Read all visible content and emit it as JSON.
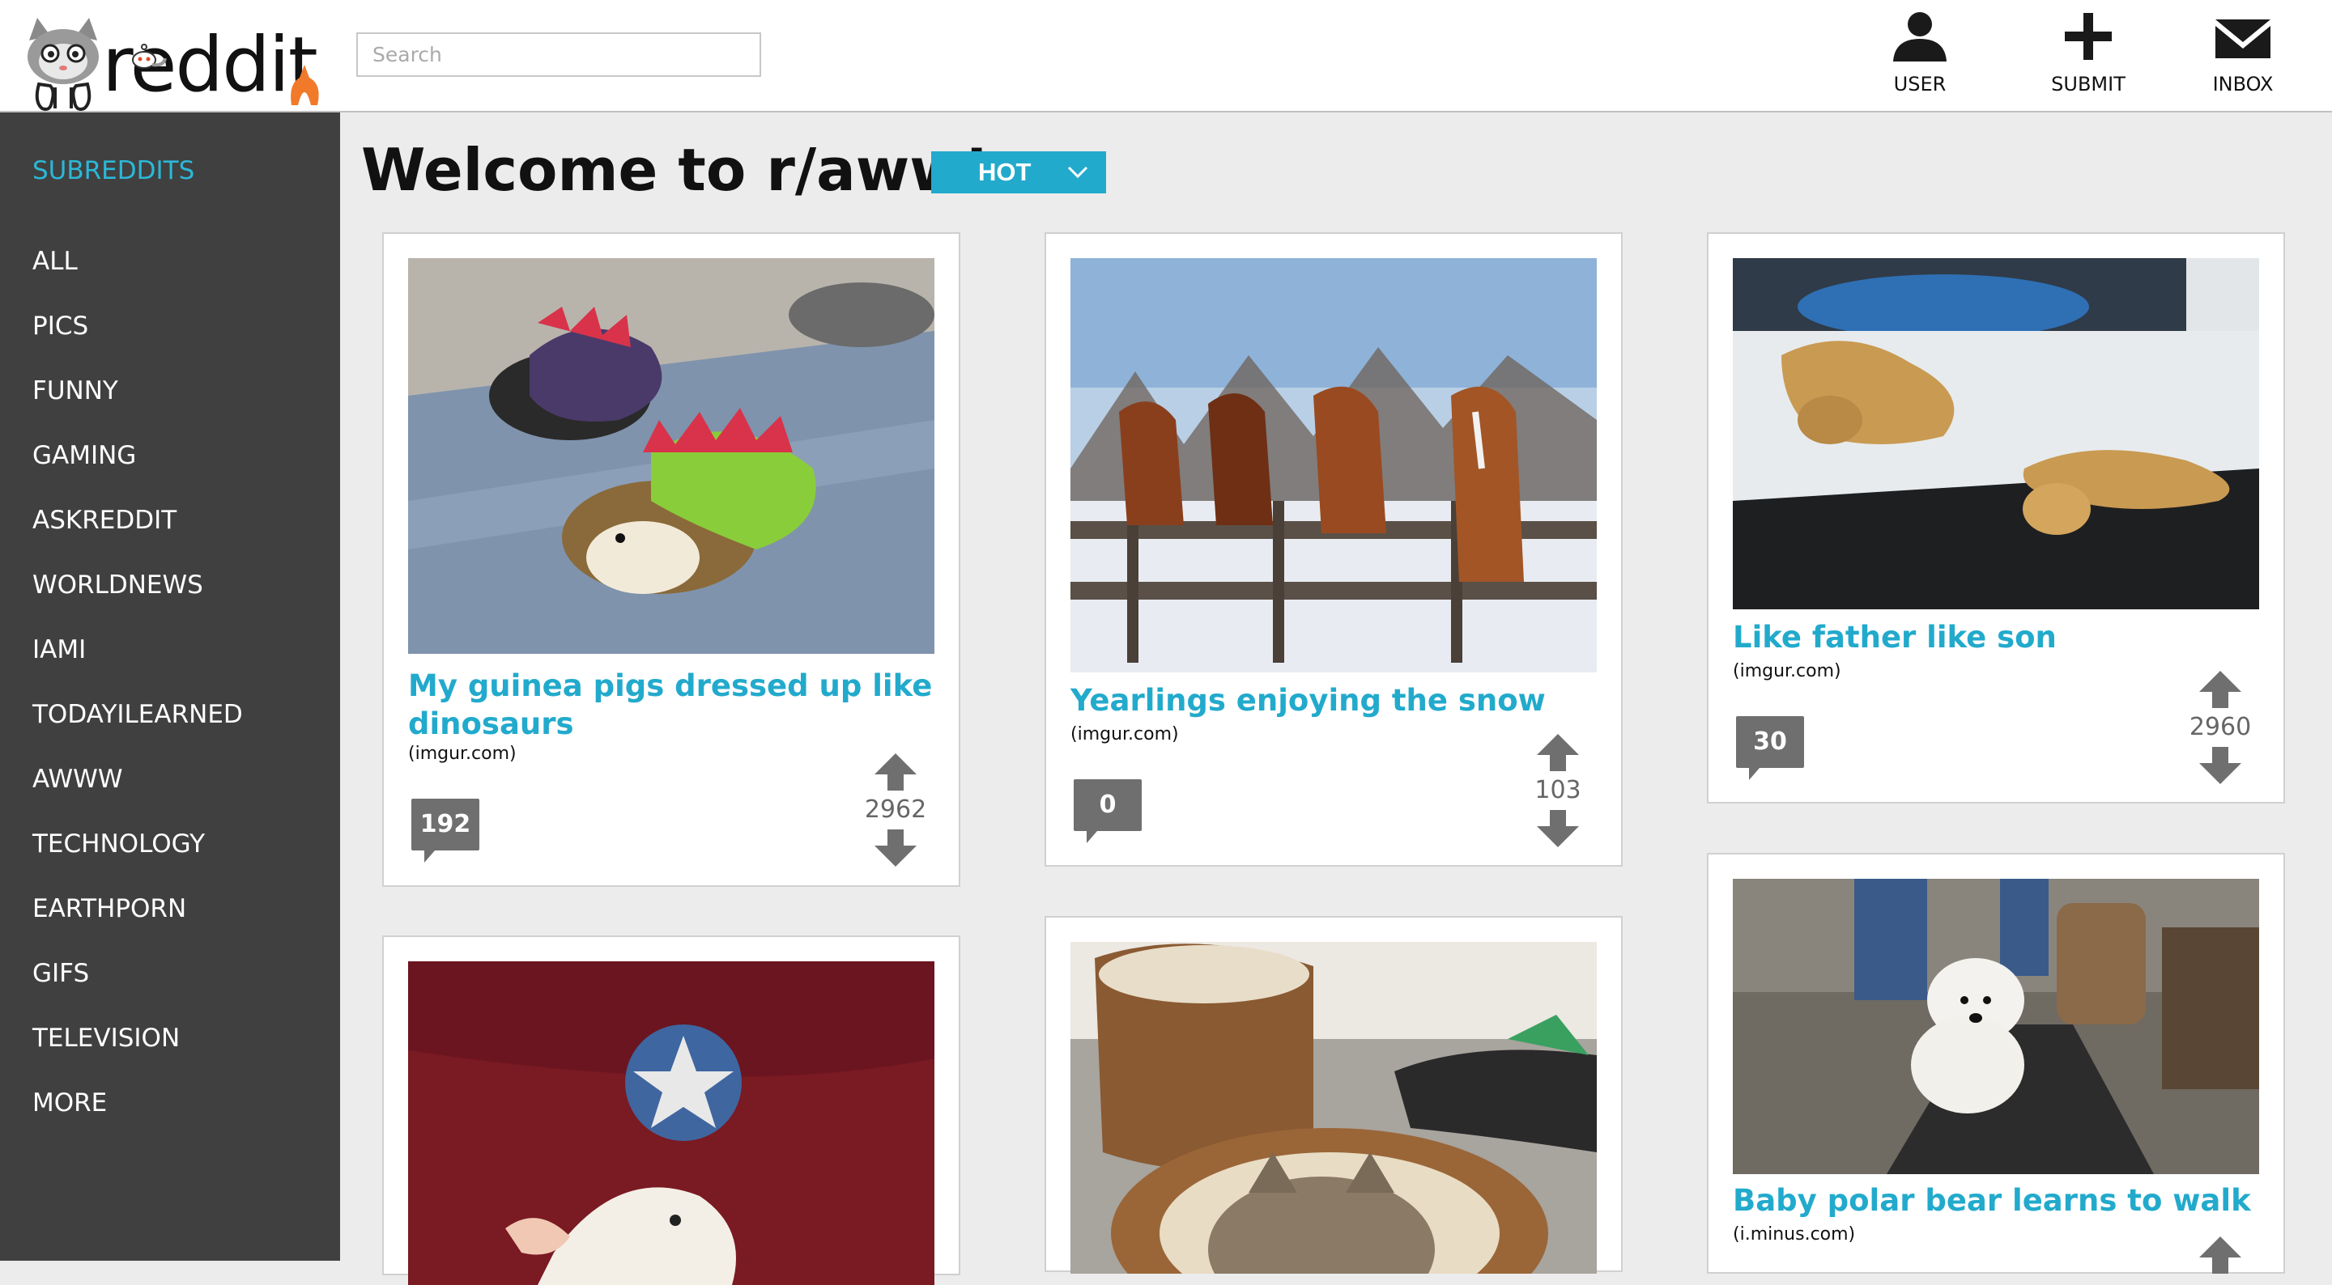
{
  "header": {
    "logo_text": "reddit",
    "search_placeholder": "Search",
    "buttons": [
      {
        "label": "USER",
        "icon": "user-icon"
      },
      {
        "label": "SUBMIT",
        "icon": "plus-icon"
      },
      {
        "label": "INBOX",
        "icon": "envelope-icon"
      }
    ]
  },
  "sidebar": {
    "title": "SUBREDDITS",
    "items": [
      "ALL",
      "PICS",
      "FUNNY",
      "GAMING",
      "ASKREDDIT",
      "WORLDNEWS",
      "IAMI",
      "TODAYILEARNED",
      "AWWW",
      "TECHNOLOGY",
      "EARTHPORN",
      "GIFS",
      "TELEVISION",
      "MORE"
    ]
  },
  "main": {
    "welcome": "Welcome to r/aww!",
    "sort_label": "HOT"
  },
  "colors": {
    "accent": "#22aacc",
    "sidebar_bg": "#404040",
    "badge": "#6f6f6f"
  },
  "posts": [
    {
      "title": "My guinea pigs dressed up like dinosaurs",
      "domain": "(imgur.com)",
      "comments": "192",
      "score": "2962"
    },
    {
      "title": "Yearlings enjoying the snow",
      "domain": "(imgur.com)",
      "comments": "0",
      "score": "103"
    },
    {
      "title": "Like father like son",
      "domain": "(imgur.com)",
      "comments": "30",
      "score": "2960"
    },
    {
      "title": "Baby polar bear learns to walk",
      "domain": "(i.minus.com)"
    },
    {},
    {}
  ]
}
